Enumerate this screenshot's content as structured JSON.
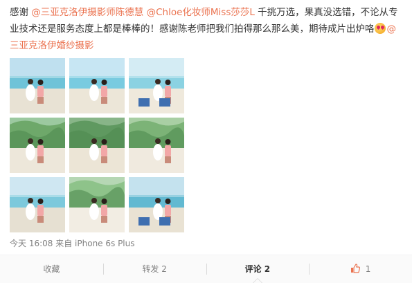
{
  "post": {
    "segments": [
      {
        "text": "感谢 ",
        "type": "text"
      },
      {
        "text": "@三亚克洛伊摄影师陈德慧",
        "type": "mention"
      },
      {
        "text": " ",
        "type": "text"
      },
      {
        "text": "@Chloe化妆师Miss莎莎L",
        "type": "mention"
      },
      {
        "text": " 千挑万选，果真没选错，不论从专业技术还是服务态度上都是棒棒的！感谢陈老师把我们拍得那么那么美，期待成片出炉咯",
        "type": "text"
      },
      {
        "text": "",
        "type": "emoji"
      },
      {
        "text": "@三亚克洛伊婚纱摄影",
        "type": "mention"
      }
    ],
    "emoji_name": "heart-eyes-emoji-icon"
  },
  "photos": [
    {
      "name": "photo-couple-beach-sitting"
    },
    {
      "name": "photo-couple-arms-raised-beach"
    },
    {
      "name": "photo-couple-closeup-beach-chair"
    },
    {
      "name": "photo-couple-sand-forest-background"
    },
    {
      "name": "photo-couple-seated-trees"
    },
    {
      "name": "photo-couple-sitting-sand-greenery"
    },
    {
      "name": "photo-couple-walking-beach"
    },
    {
      "name": "photo-couple-kiss-closeup"
    },
    {
      "name": "photo-couple-beach-chairs-back-view"
    }
  ],
  "meta": {
    "time": "今天 16:08",
    "source": "来自 iPhone 6s Plus"
  },
  "actions": {
    "favorite": "收藏",
    "repost": "转发 2",
    "comment": "评论 2",
    "like_count": "1"
  },
  "colors": {
    "mention": "#eb7350",
    "like": "#eb7350"
  }
}
